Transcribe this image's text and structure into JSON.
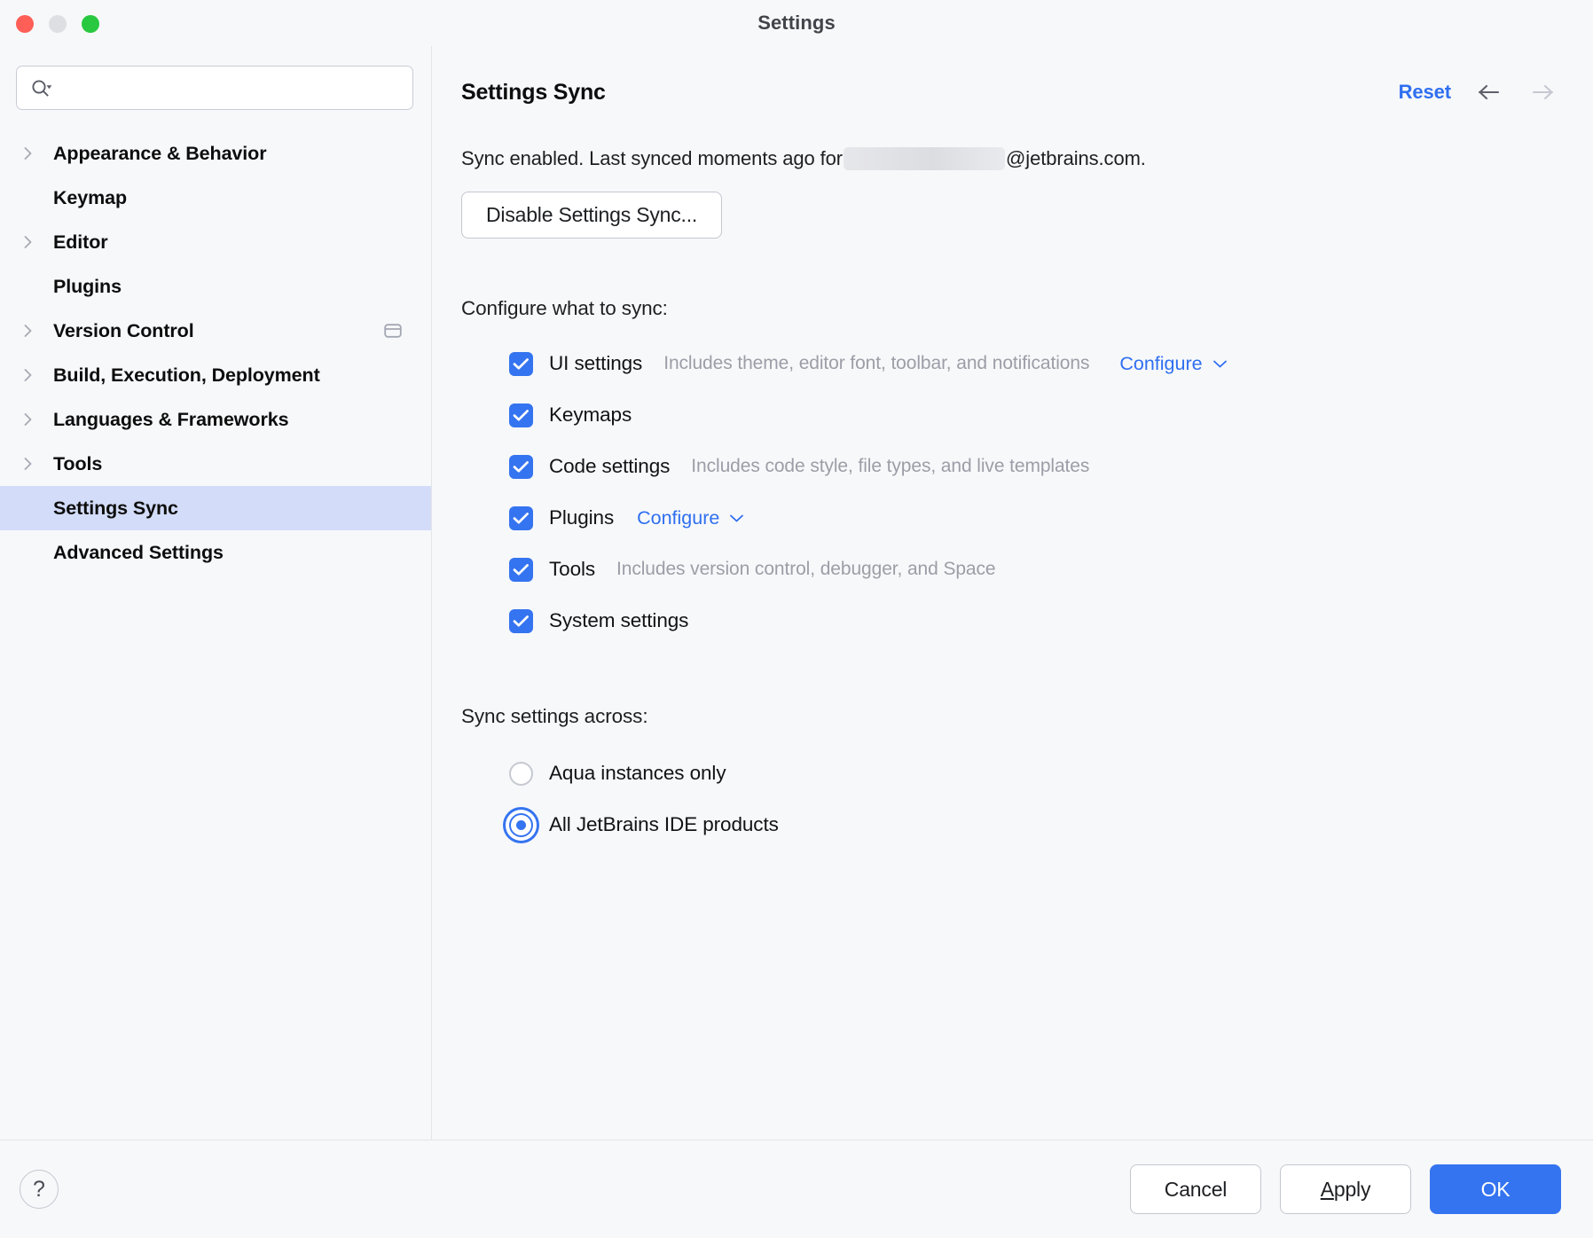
{
  "window": {
    "title": "Settings",
    "traffic_lights": [
      "close-button",
      "minimize-button",
      "maximize-button"
    ]
  },
  "sidebar": {
    "search": {
      "value": "",
      "placeholder": "",
      "icon": "search-icon"
    },
    "items": [
      {
        "label": "Appearance & Behavior",
        "expandable": true,
        "selected": false,
        "trailing_icon": ""
      },
      {
        "label": "Keymap",
        "expandable": false,
        "selected": false,
        "trailing_icon": ""
      },
      {
        "label": "Editor",
        "expandable": true,
        "selected": false,
        "trailing_icon": ""
      },
      {
        "label": "Plugins",
        "expandable": false,
        "selected": false,
        "trailing_icon": ""
      },
      {
        "label": "Version Control",
        "expandable": true,
        "selected": false,
        "trailing_icon": "panel-window-icon"
      },
      {
        "label": "Build, Execution, Deployment",
        "expandable": true,
        "selected": false,
        "trailing_icon": ""
      },
      {
        "label": "Languages & Frameworks",
        "expandable": true,
        "selected": false,
        "trailing_icon": ""
      },
      {
        "label": "Tools",
        "expandable": true,
        "selected": false,
        "trailing_icon": ""
      },
      {
        "label": "Settings Sync",
        "expandable": false,
        "selected": true,
        "trailing_icon": ""
      },
      {
        "label": "Advanced Settings",
        "expandable": false,
        "selected": false,
        "trailing_icon": ""
      }
    ]
  },
  "main": {
    "page_title": "Settings Sync",
    "reset_label": "Reset",
    "nav": {
      "back": "back-arrow-icon",
      "forward": "forward-arrow-icon",
      "back_enabled": true,
      "forward_enabled": false
    },
    "status": {
      "prefix": "Sync enabled. Last synced moments ago for ",
      "redacted_account": "",
      "suffix": "@jetbrains.com."
    },
    "disable_button": "Disable Settings Sync...",
    "configure_section_label": "Configure what to sync:",
    "sync_items": [
      {
        "label": "UI settings",
        "checked": true,
        "description": "Includes theme, editor font, toolbar, and notifications",
        "link": "Configure"
      },
      {
        "label": "Keymaps",
        "checked": true,
        "description": "",
        "link": ""
      },
      {
        "label": "Code settings",
        "checked": true,
        "description": "Includes code style, file types, and live templates",
        "link": ""
      },
      {
        "label": "Plugins",
        "checked": true,
        "description": "",
        "link": "Configure"
      },
      {
        "label": "Tools",
        "checked": true,
        "description": "Includes version control, debugger, and Space",
        "link": ""
      },
      {
        "label": "System settings",
        "checked": true,
        "description": "",
        "link": ""
      }
    ],
    "across_section_label": "Sync settings across:",
    "across_options": [
      {
        "label": "Aqua instances only",
        "selected": false
      },
      {
        "label": "All JetBrains IDE products",
        "selected": true
      }
    ]
  },
  "footer": {
    "help_label": "?",
    "cancel_label": "Cancel",
    "apply_mnemonic": "A",
    "apply_rest": "pply",
    "ok_label": "OK"
  },
  "colors": {
    "accent": "#3574f0",
    "link": "#2f6ff0",
    "selection": "#d3dcf8",
    "background": "#f7f8fa",
    "muted_text": "#9b9ea6"
  }
}
